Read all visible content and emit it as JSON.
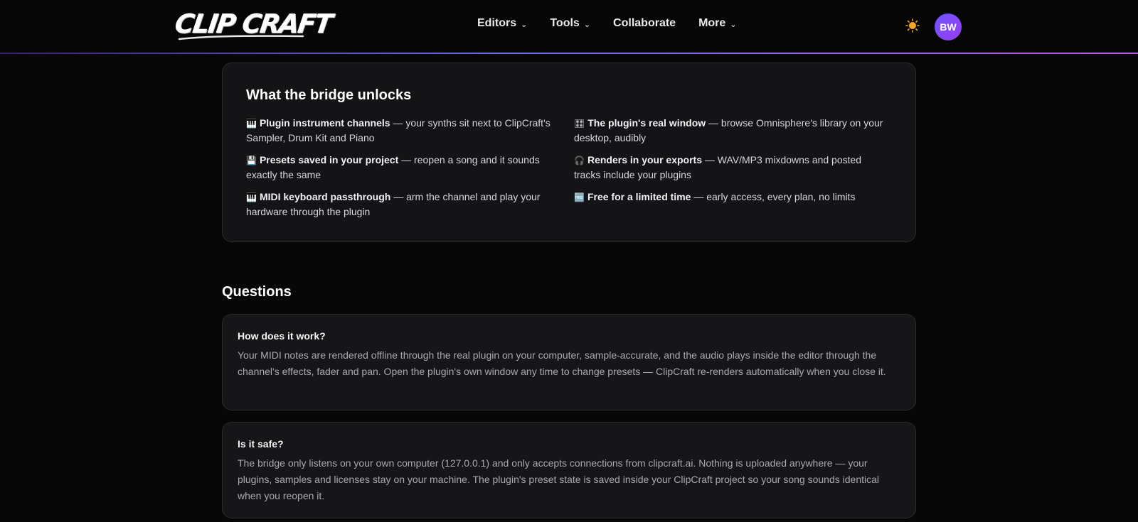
{
  "header": {
    "logo_text": "CLIP CRAFT",
    "nav": [
      {
        "label": "Editors",
        "has_dropdown": true
      },
      {
        "label": "Tools",
        "has_dropdown": true
      },
      {
        "label": "Collaborate",
        "has_dropdown": false
      },
      {
        "label": "More",
        "has_dropdown": true
      }
    ],
    "theme_icon": "sun-icon",
    "avatar_initials": "BW"
  },
  "unlocks": {
    "title": "What the bridge unlocks",
    "features": [
      {
        "icon": "🎹",
        "title": "Plugin instrument channels",
        "text": " — your synths sit next to ClipCraft's Sampler, Drum Kit and Piano"
      },
      {
        "icon": "🎛",
        "title": "The plugin's real window",
        "text": " — browse Omnisphere's library on your desktop, audibly"
      },
      {
        "icon": "💾",
        "title": "Presets saved in your project",
        "text": " — reopen a song and it sounds exactly the same"
      },
      {
        "icon": "🎧",
        "title": "Renders in your exports",
        "text": " — WAV/MP3 mixdowns and posted tracks include your plugins"
      },
      {
        "icon": "🎹",
        "title": "MIDI keyboard passthrough",
        "text": " — arm the channel and play your hardware through the plugin"
      },
      {
        "icon": "🆓",
        "title": "Free for a limited time",
        "text": " — early access, every plan, no limits"
      }
    ]
  },
  "questions": {
    "heading": "Questions",
    "items": [
      {
        "question": "How does it work?",
        "answer": "Your MIDI notes are rendered offline through the real plugin on your computer, sample-accurate, and the audio plays inside the editor through the channel's effects, fader and pan. Open the plugin's own window any time to change presets — ClipCraft re-renders automatically when you close it."
      },
      {
        "question": "Is it safe?",
        "answer": "The bridge only listens on your own computer (127.0.0.1) and only accepts connections from clipcraft.ai. Nothing is uploaded anywhere — your plugins, samples and licenses stay on your machine. The plugin's preset state is saved inside your ClipCraft project so your song sounds identical when you reopen it."
      }
    ]
  },
  "colors": {
    "background": "#070708",
    "card": "#141416",
    "accent_purple": "#8b46f0",
    "accent_line": "#6f6ff0"
  }
}
